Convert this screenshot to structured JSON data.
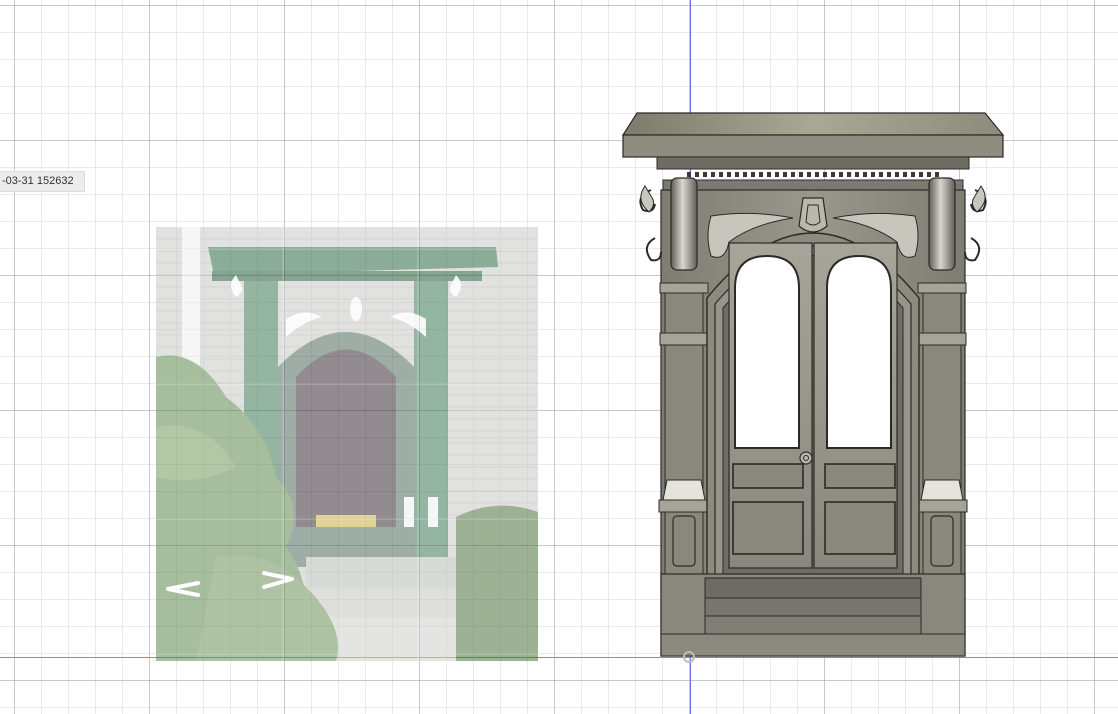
{
  "viewport": {
    "canvas_label": "-03-31 152632",
    "grid": true,
    "colors": {
      "background": "#ffffff",
      "grid_major": "#a6aeb7",
      "grid_minor": "#c8cdd3",
      "axis_y": "#6b73e6",
      "axis_x": "#e8686b",
      "model_body": "#8d8b80",
      "photo_trim": "#2f6b43"
    }
  },
  "canvas_image": {
    "icons": [
      "arrow-left-icon",
      "arrow-right-icon"
    ]
  },
  "model": {
    "icons": [
      "door-knob-icon"
    ]
  }
}
